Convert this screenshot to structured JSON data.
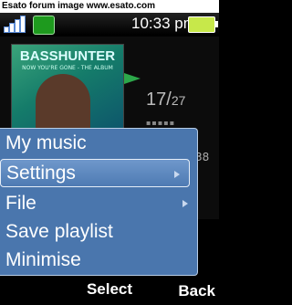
{
  "watermark": "Esato forum image www.esato.com",
  "status": {
    "time": "10:33 pm",
    "signal_icon": "signal-strength-icon",
    "gprs_icon": "gprs-icon",
    "battery_icon": "battery-charging-icon"
  },
  "player": {
    "album_title": "BASSHUNTER",
    "album_subtitle": "NOW YOU'RE GONE - THE ALBUM",
    "track_current": "17/",
    "track_total": "27",
    "elapsed": "38",
    "play_icon": "play-icon"
  },
  "menu": {
    "items": [
      {
        "label": "My music"
      },
      {
        "label": "Settings"
      },
      {
        "label": "File"
      },
      {
        "label": "Save playlist"
      },
      {
        "label": "Minimise"
      }
    ],
    "selected_index": 1
  },
  "softkeys": {
    "center": "Select",
    "right": "Back"
  },
  "colors": {
    "menu_bg": "#4a76ad",
    "menu_border": "#b8cde6",
    "play_green": "#2ca84a"
  }
}
